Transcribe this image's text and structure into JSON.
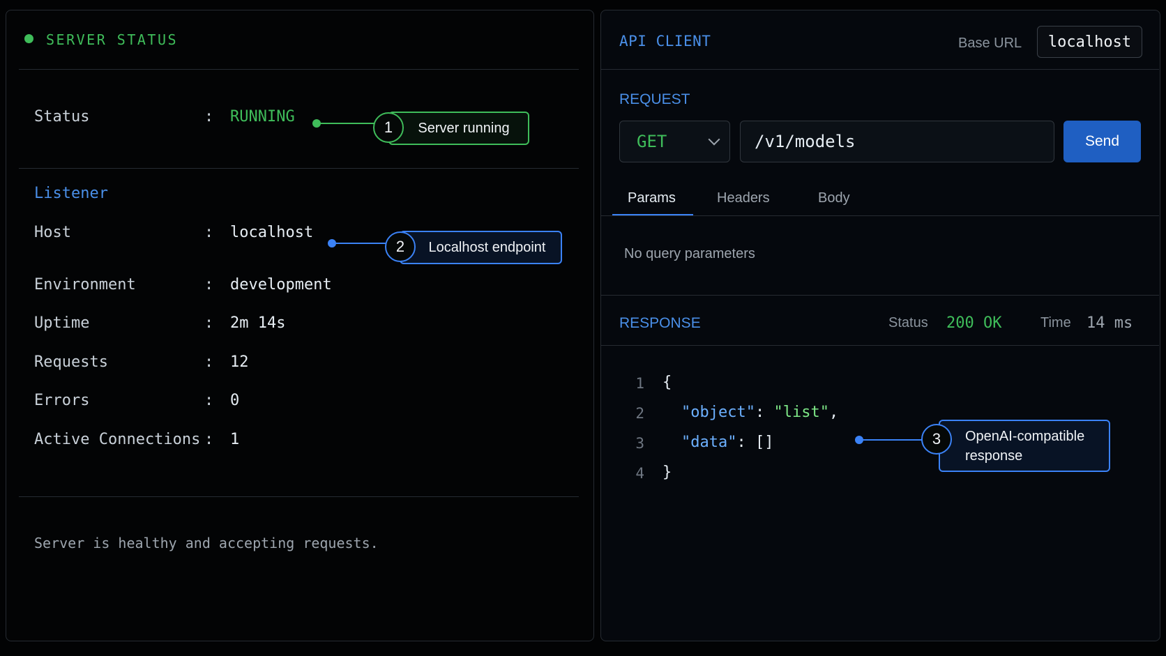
{
  "server_status": {
    "title": "SERVER STATUS",
    "status": {
      "label": "Status",
      "value": "RUNNING"
    },
    "listener": {
      "heading": "Listener",
      "rows": [
        {
          "label": "Host",
          "value": "localhost"
        },
        {
          "label": "Environment",
          "value": "development"
        },
        {
          "label": "Uptime",
          "value": "2m 14s"
        },
        {
          "label": "Requests",
          "value": "12"
        },
        {
          "label": "Errors",
          "value": "0"
        },
        {
          "label": "Active Connections",
          "value": "1"
        }
      ]
    },
    "colon": ":",
    "footer": "Server is healthy and accepting requests."
  },
  "api_client": {
    "title": "API CLIENT",
    "base_url_label": "Base URL",
    "base_url_value": "localhost",
    "request": {
      "heading": "REQUEST",
      "method": "GET",
      "path": "/v1/models",
      "send_label": "Send",
      "tabs": [
        "Params",
        "Headers",
        "Body"
      ],
      "active_tab": "Params",
      "params_empty": "No query parameters"
    },
    "response": {
      "heading": "RESPONSE",
      "status_label": "Status",
      "status_value": "200 OK",
      "time_label": "Time",
      "time_value": "14 ms",
      "line_numbers": [
        "1",
        "2",
        "3",
        "4"
      ],
      "code": {
        "open": "{",
        "k1": "\"object\"",
        "v1": "\"list\"",
        "k2": "\"data\"",
        "v2": "[]",
        "close": "}"
      }
    }
  },
  "callouts": [
    {
      "number": "1",
      "text": "Server running"
    },
    {
      "number": "2",
      "text": "Localhost endpoint"
    },
    {
      "number": "3",
      "text": "OpenAI-compatible response"
    }
  ],
  "colors": {
    "accent_green": "#3fbd5a",
    "accent_blue": "#3b82f6",
    "send_button": "#1f5fc2"
  }
}
